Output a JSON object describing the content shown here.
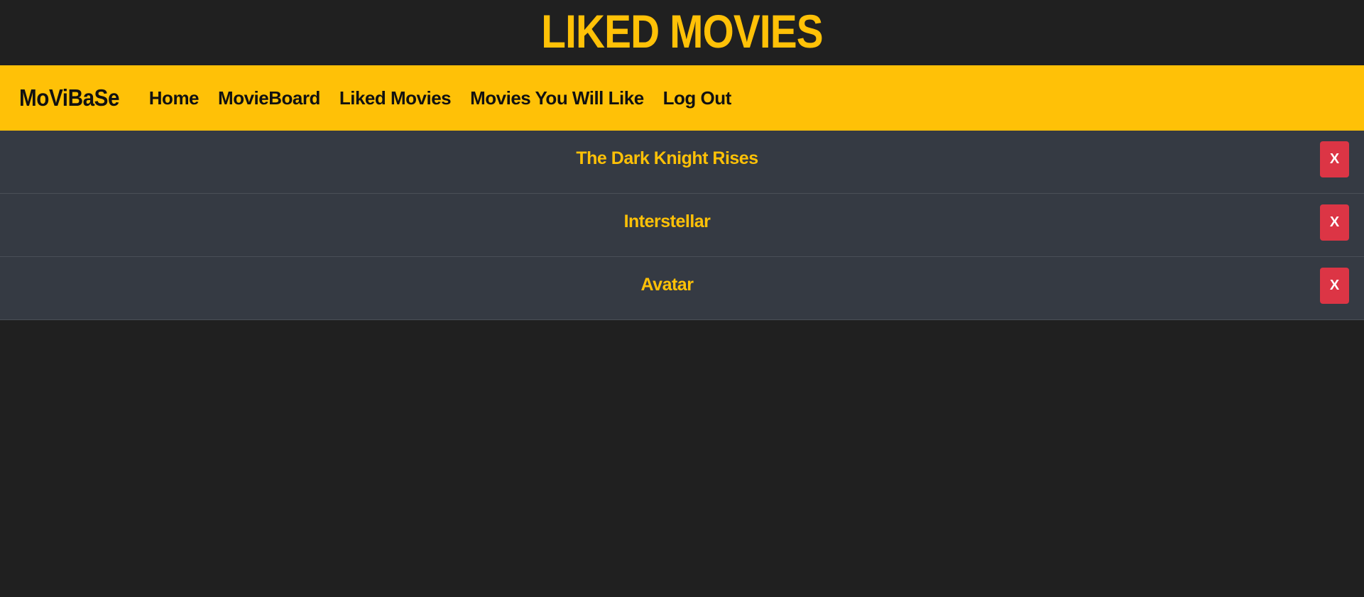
{
  "header": {
    "title": "LIKED MOVIES"
  },
  "navbar": {
    "brand": "MoViBaSe",
    "links": [
      {
        "label": "Home"
      },
      {
        "label": "MovieBoard"
      },
      {
        "label": "Liked Movies"
      },
      {
        "label": "Movies You Will Like"
      },
      {
        "label": "Log Out"
      }
    ]
  },
  "movies": [
    {
      "title": "The Dark Knight Rises",
      "remove_label": "X"
    },
    {
      "title": "Interstellar",
      "remove_label": "X"
    },
    {
      "title": "Avatar",
      "remove_label": "X"
    }
  ],
  "colors": {
    "accent": "#ffc107",
    "background": "#202020",
    "row_background": "#353a43",
    "danger": "#dc3545"
  }
}
